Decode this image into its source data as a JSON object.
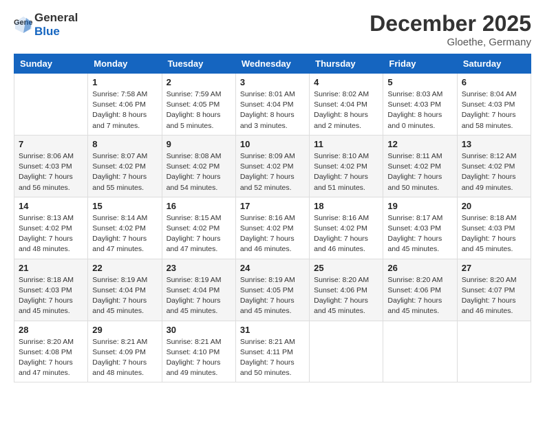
{
  "header": {
    "logo_general": "General",
    "logo_blue": "Blue",
    "month": "December 2025",
    "location": "Gloethe, Germany"
  },
  "weekdays": [
    "Sunday",
    "Monday",
    "Tuesday",
    "Wednesday",
    "Thursday",
    "Friday",
    "Saturday"
  ],
  "weeks": [
    [
      {
        "day": "",
        "sunrise": "",
        "sunset": "",
        "daylight": ""
      },
      {
        "day": "1",
        "sunrise": "Sunrise: 7:58 AM",
        "sunset": "Sunset: 4:06 PM",
        "daylight": "Daylight: 8 hours and 7 minutes."
      },
      {
        "day": "2",
        "sunrise": "Sunrise: 7:59 AM",
        "sunset": "Sunset: 4:05 PM",
        "daylight": "Daylight: 8 hours and 5 minutes."
      },
      {
        "day": "3",
        "sunrise": "Sunrise: 8:01 AM",
        "sunset": "Sunset: 4:04 PM",
        "daylight": "Daylight: 8 hours and 3 minutes."
      },
      {
        "day": "4",
        "sunrise": "Sunrise: 8:02 AM",
        "sunset": "Sunset: 4:04 PM",
        "daylight": "Daylight: 8 hours and 2 minutes."
      },
      {
        "day": "5",
        "sunrise": "Sunrise: 8:03 AM",
        "sunset": "Sunset: 4:03 PM",
        "daylight": "Daylight: 8 hours and 0 minutes."
      },
      {
        "day": "6",
        "sunrise": "Sunrise: 8:04 AM",
        "sunset": "Sunset: 4:03 PM",
        "daylight": "Daylight: 7 hours and 58 minutes."
      }
    ],
    [
      {
        "day": "7",
        "sunrise": "Sunrise: 8:06 AM",
        "sunset": "Sunset: 4:03 PM",
        "daylight": "Daylight: 7 hours and 56 minutes."
      },
      {
        "day": "8",
        "sunrise": "Sunrise: 8:07 AM",
        "sunset": "Sunset: 4:02 PM",
        "daylight": "Daylight: 7 hours and 55 minutes."
      },
      {
        "day": "9",
        "sunrise": "Sunrise: 8:08 AM",
        "sunset": "Sunset: 4:02 PM",
        "daylight": "Daylight: 7 hours and 54 minutes."
      },
      {
        "day": "10",
        "sunrise": "Sunrise: 8:09 AM",
        "sunset": "Sunset: 4:02 PM",
        "daylight": "Daylight: 7 hours and 52 minutes."
      },
      {
        "day": "11",
        "sunrise": "Sunrise: 8:10 AM",
        "sunset": "Sunset: 4:02 PM",
        "daylight": "Daylight: 7 hours and 51 minutes."
      },
      {
        "day": "12",
        "sunrise": "Sunrise: 8:11 AM",
        "sunset": "Sunset: 4:02 PM",
        "daylight": "Daylight: 7 hours and 50 minutes."
      },
      {
        "day": "13",
        "sunrise": "Sunrise: 8:12 AM",
        "sunset": "Sunset: 4:02 PM",
        "daylight": "Daylight: 7 hours and 49 minutes."
      }
    ],
    [
      {
        "day": "14",
        "sunrise": "Sunrise: 8:13 AM",
        "sunset": "Sunset: 4:02 PM",
        "daylight": "Daylight: 7 hours and 48 minutes."
      },
      {
        "day": "15",
        "sunrise": "Sunrise: 8:14 AM",
        "sunset": "Sunset: 4:02 PM",
        "daylight": "Daylight: 7 hours and 47 minutes."
      },
      {
        "day": "16",
        "sunrise": "Sunrise: 8:15 AM",
        "sunset": "Sunset: 4:02 PM",
        "daylight": "Daylight: 7 hours and 47 minutes."
      },
      {
        "day": "17",
        "sunrise": "Sunrise: 8:16 AM",
        "sunset": "Sunset: 4:02 PM",
        "daylight": "Daylight: 7 hours and 46 minutes."
      },
      {
        "day": "18",
        "sunrise": "Sunrise: 8:16 AM",
        "sunset": "Sunset: 4:02 PM",
        "daylight": "Daylight: 7 hours and 46 minutes."
      },
      {
        "day": "19",
        "sunrise": "Sunrise: 8:17 AM",
        "sunset": "Sunset: 4:03 PM",
        "daylight": "Daylight: 7 hours and 45 minutes."
      },
      {
        "day": "20",
        "sunrise": "Sunrise: 8:18 AM",
        "sunset": "Sunset: 4:03 PM",
        "daylight": "Daylight: 7 hours and 45 minutes."
      }
    ],
    [
      {
        "day": "21",
        "sunrise": "Sunrise: 8:18 AM",
        "sunset": "Sunset: 4:03 PM",
        "daylight": "Daylight: 7 hours and 45 minutes."
      },
      {
        "day": "22",
        "sunrise": "Sunrise: 8:19 AM",
        "sunset": "Sunset: 4:04 PM",
        "daylight": "Daylight: 7 hours and 45 minutes."
      },
      {
        "day": "23",
        "sunrise": "Sunrise: 8:19 AM",
        "sunset": "Sunset: 4:04 PM",
        "daylight": "Daylight: 7 hours and 45 minutes."
      },
      {
        "day": "24",
        "sunrise": "Sunrise: 8:19 AM",
        "sunset": "Sunset: 4:05 PM",
        "daylight": "Daylight: 7 hours and 45 minutes."
      },
      {
        "day": "25",
        "sunrise": "Sunrise: 8:20 AM",
        "sunset": "Sunset: 4:06 PM",
        "daylight": "Daylight: 7 hours and 45 minutes."
      },
      {
        "day": "26",
        "sunrise": "Sunrise: 8:20 AM",
        "sunset": "Sunset: 4:06 PM",
        "daylight": "Daylight: 7 hours and 45 minutes."
      },
      {
        "day": "27",
        "sunrise": "Sunrise: 8:20 AM",
        "sunset": "Sunset: 4:07 PM",
        "daylight": "Daylight: 7 hours and 46 minutes."
      }
    ],
    [
      {
        "day": "28",
        "sunrise": "Sunrise: 8:20 AM",
        "sunset": "Sunset: 4:08 PM",
        "daylight": "Daylight: 7 hours and 47 minutes."
      },
      {
        "day": "29",
        "sunrise": "Sunrise: 8:21 AM",
        "sunset": "Sunset: 4:09 PM",
        "daylight": "Daylight: 7 hours and 48 minutes."
      },
      {
        "day": "30",
        "sunrise": "Sunrise: 8:21 AM",
        "sunset": "Sunset: 4:10 PM",
        "daylight": "Daylight: 7 hours and 49 minutes."
      },
      {
        "day": "31",
        "sunrise": "Sunrise: 8:21 AM",
        "sunset": "Sunset: 4:11 PM",
        "daylight": "Daylight: 7 hours and 50 minutes."
      },
      {
        "day": "",
        "sunrise": "",
        "sunset": "",
        "daylight": ""
      },
      {
        "day": "",
        "sunrise": "",
        "sunset": "",
        "daylight": ""
      },
      {
        "day": "",
        "sunrise": "",
        "sunset": "",
        "daylight": ""
      }
    ]
  ]
}
